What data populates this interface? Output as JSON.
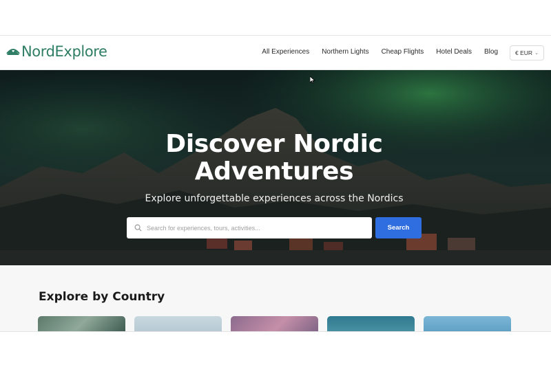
{
  "brand": {
    "name": "NordExplore",
    "logo_icon": "mountain-icon",
    "color": "#2e7d64"
  },
  "nav": {
    "items": [
      {
        "label": "All Experiences"
      },
      {
        "label": "Northern Lights"
      },
      {
        "label": "Cheap Flights"
      },
      {
        "label": "Hotel Deals"
      },
      {
        "label": "Blog"
      }
    ],
    "currency": "€ EUR"
  },
  "hero": {
    "title": "Discover Nordic Adventures",
    "subtitle": "Explore unforgettable experiences across the Nordics",
    "search": {
      "placeholder": "Search for experiences, tours, activities...",
      "value": "",
      "button_label": "Search",
      "button_color": "#2f6ee0"
    }
  },
  "sections": {
    "explore_by_country": {
      "title": "Explore by Country"
    }
  }
}
